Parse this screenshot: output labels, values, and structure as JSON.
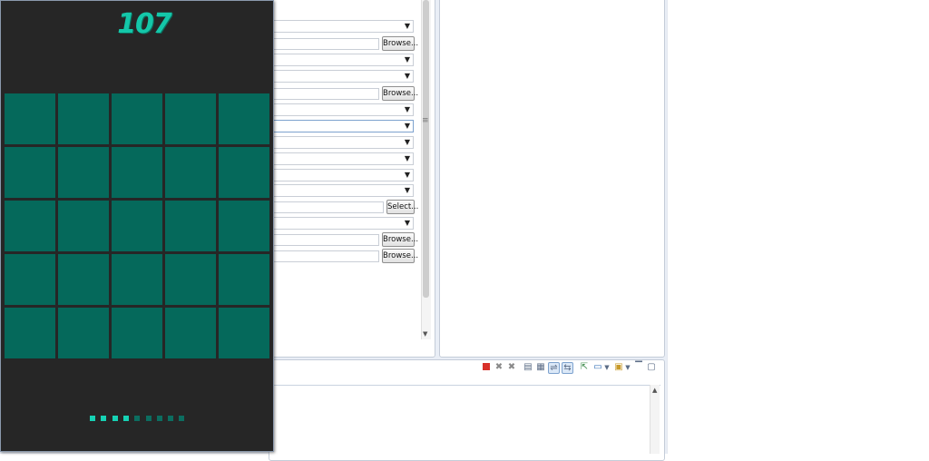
{
  "properties": {
    "rows": [
      {
        "kind": "combo"
      },
      {
        "kind": "text",
        "button": "Browse..."
      },
      {
        "kind": "combo"
      },
      {
        "kind": "combo"
      },
      {
        "kind": "text",
        "button": "Browse..."
      },
      {
        "kind": "combo"
      },
      {
        "kind": "combo",
        "focused": true
      },
      {
        "kind": "combo"
      },
      {
        "kind": "combo"
      },
      {
        "kind": "combo"
      },
      {
        "kind": "combo"
      },
      {
        "kind": "text",
        "button": "Select..."
      },
      {
        "kind": "combo"
      },
      {
        "kind": "text",
        "button": "Browse..."
      },
      {
        "kind": "text",
        "button": "Browse..."
      }
    ],
    "browse_label": "Browse...",
    "select_label": "Select..."
  },
  "console": {
    "toolbar_icons": [
      "terminate-icon",
      "remove-launch-icon",
      "remove-all-icon",
      "clear-console-icon",
      "scroll-lock-icon",
      "word-wrap-icon",
      "show-on-output-icon",
      "pin-console-icon",
      "display-console-icon",
      "open-console-icon",
      "minimize-icon",
      "maximize-icon"
    ]
  },
  "game": {
    "score": "107",
    "grid_rows": 5,
    "grid_cols": 5,
    "level_dots_total": 9,
    "level_dots_filled": 4,
    "colors": {
      "background": "#262626",
      "cell": "#05695b",
      "accent": "#14c7a9",
      "dot_on": "#16d2b4",
      "dot_off": "#0c6d60"
    }
  }
}
